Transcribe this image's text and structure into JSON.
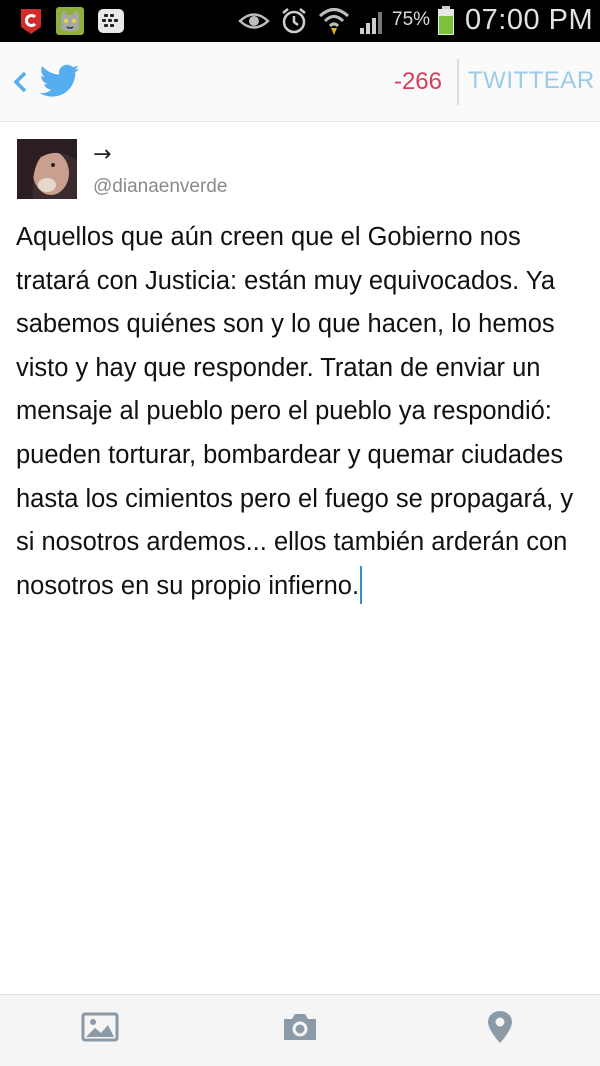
{
  "status_bar": {
    "battery_percent": "75%",
    "time": "07:00 PM",
    "icons": [
      "c-app-icon",
      "talking-cat-app-icon",
      "bbm-icon",
      "eye-icon",
      "alarm-icon",
      "wifi-icon",
      "signal-icon",
      "battery-icon"
    ]
  },
  "header": {
    "char_count": "-266",
    "tweet_button_label": "TWITTEAR",
    "icons": [
      "back-chevron-icon",
      "twitter-bird-icon"
    ]
  },
  "compose": {
    "display_name": "→",
    "handle": "@dianaenverde",
    "text": "Aquellos que aún creen que el Gobierno nos tratará con Justicia: están muy equivocados. Ya sabemos quiénes son y lo que hacen, lo hemos visto y hay que responder. Tratan de enviar un mensaje al pueblo pero el pueblo ya respondió: pueden torturar, bombardear y quemar ciudades hasta los cimientos pero el fuego se propagará, y si nosotros ardemos... ellos también arderán con nosotros en su propio infierno."
  },
  "toolbar": {
    "icons": [
      "photo-icon",
      "camera-icon",
      "location-pin-icon"
    ]
  },
  "colors": {
    "twitter_blue": "#55acee",
    "char_count_red": "#d93c56",
    "tweet_button": "#9ccbe8",
    "caret": "#3b8dd4",
    "toolbar_icon": "#8a9aa6"
  }
}
